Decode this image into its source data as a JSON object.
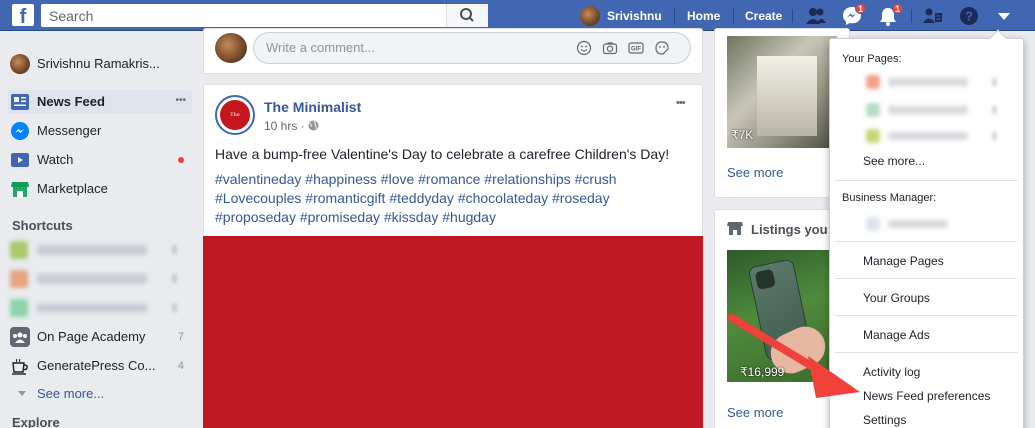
{
  "topbar": {
    "logo": "f",
    "search_placeholder": "Search",
    "user_name": "Srivishnu",
    "home": "Home",
    "create": "Create",
    "messenger_badge": "1",
    "notifications_badge": "1"
  },
  "left": {
    "profile_name": "Srivishnu Ramakris...",
    "nav": [
      {
        "label": "News Feed"
      },
      {
        "label": "Messenger"
      },
      {
        "label": "Watch"
      },
      {
        "label": "Marketplace"
      }
    ],
    "shortcuts_title": "Shortcuts",
    "shortcuts": [
      {
        "label": "On Page Academy",
        "count": "7"
      },
      {
        "label": "GeneratePress Co...",
        "count": "4"
      }
    ],
    "see_more": "See more...",
    "explore_title": "Explore",
    "more_dots": "•••"
  },
  "composer": {
    "placeholder": "Write a comment..."
  },
  "post": {
    "author": "The Minimalist",
    "avatar_text": "The Minimalist",
    "time": "10 hrs · ",
    "text": "Have a bump-free Valentine's Day to celebrate a carefree Children's Day!",
    "tags_line1": "#valentineday #happiness #love #romance #relationships #crush",
    "tags_line2": "#Lovecouples #romanticgift #teddyday #chocolateday #roseday",
    "tags_line3": "#proposeday #promiseday #kissday #hugday",
    "more_dots": "•••"
  },
  "right": {
    "price1": "₹7K",
    "see_more_1": "See more",
    "listings_title": "Listings you",
    "price2": "₹16,999",
    "see_more_2": "See more"
  },
  "dropdown": {
    "your_pages": "Your Pages:",
    "see_more": "See more...",
    "business_manager": "Business Manager:",
    "items": [
      "Manage Pages",
      "Your Groups",
      "Manage Ads",
      "Activity log",
      "News Feed preferences",
      "Settings"
    ]
  },
  "colors": {
    "brand": "#4267b2",
    "link": "#365899",
    "arrow": "#f0413a",
    "badge": "#fa3e3e"
  }
}
